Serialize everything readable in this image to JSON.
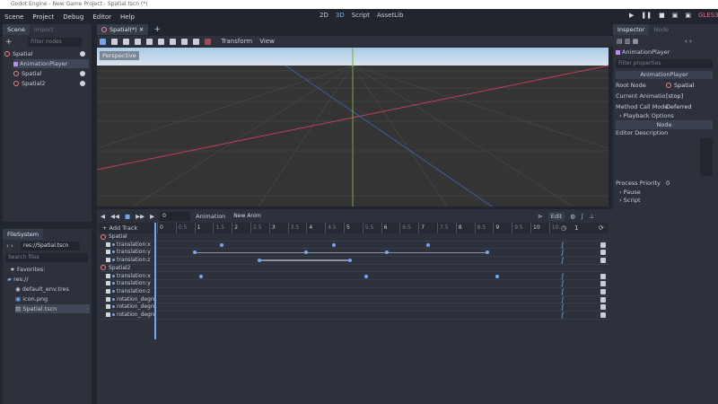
{
  "window": {
    "title": "Godot Engine - New Game Project - Spatial.tscn (*)"
  },
  "menu": [
    "Scene",
    "Project",
    "Debug",
    "Editor",
    "Help"
  ],
  "workspaces": {
    "d2": "2D",
    "d3": "3D",
    "script": "Script",
    "assetlib": "AssetLib"
  },
  "renderer": "GLES3",
  "scene_dock": {
    "tabs": [
      "Scene",
      "Import"
    ],
    "filter_placeholder": "Filter nodes",
    "tree": [
      {
        "name": "Spatial",
        "level": 0
      },
      {
        "name": "AnimationPlayer",
        "level": 1
      },
      {
        "name": "Spatial",
        "level": 1
      },
      {
        "name": "Spatial2",
        "level": 1
      }
    ]
  },
  "filesystem": {
    "tab": "FileSystem",
    "path": "res://Spatial.tscn",
    "search_placeholder": "Search files",
    "favorites": "Favorites:",
    "root": "res://",
    "files": [
      "default_env.tres",
      "icon.png",
      "Spatial.tscn"
    ]
  },
  "editor_tabs": {
    "scene_tab": "Spatial(*)"
  },
  "viewport_toolbar": {
    "transform": "Transform",
    "view": "View",
    "perspective": "Perspective"
  },
  "animation": {
    "frame": "0",
    "animation_label": "Animation",
    "anim_name": "New Anim",
    "edit": "Edit",
    "add_track": "Add Track",
    "length": "1",
    "ticks": [
      "0",
      "0.5",
      "1",
      "1.5",
      "2",
      "2.5",
      "3",
      "3.5",
      "4",
      "4.5",
      "5",
      "5.5",
      "6",
      "6.5",
      "7",
      "7.5",
      "8",
      "8.5",
      "9",
      "9.5",
      "10",
      "10."
    ],
    "groups": [
      {
        "node": "Spatial",
        "tracks": [
          {
            "name": "translation:x",
            "keys": [
              1.73,
              4.74,
              7.26
            ],
            "segments": []
          },
          {
            "name": "translation:y",
            "keys": [
              1.0,
              4.0,
              6.15,
              8.85
            ],
            "segments": [
              [
                1.0,
                8.85
              ]
            ]
          },
          {
            "name": "translation:z",
            "keys": [
              2.74,
              5.17
            ],
            "segments": [
              [
                2.74,
                5.17
              ]
            ]
          }
        ]
      },
      {
        "node": "Spatial2",
        "tracks": [
          {
            "name": "translation:x",
            "keys": [
              1.18,
              5.6,
              9.1
            ],
            "segments": []
          },
          {
            "name": "translation:y",
            "keys": [],
            "segments": []
          },
          {
            "name": "translation:z",
            "keys": [],
            "segments": []
          },
          {
            "name": "rotation_degre",
            "keys": [],
            "segments": []
          },
          {
            "name": "rotation_degre",
            "keys": [],
            "segments": []
          },
          {
            "name": "rotation_degre",
            "keys": [],
            "segments": []
          }
        ]
      }
    ]
  },
  "inspector": {
    "tabs": [
      "Inspector",
      "Node"
    ],
    "object": "AnimationPlayer",
    "filter_placeholder": "Filter properties",
    "section": "AnimationPlayer",
    "root_node_label": "Root Node",
    "root_node": "Spatial",
    "current_anim_label": "Current Animatio",
    "current_anim": "[stop]",
    "method_call_label": "Method Call Mode",
    "method_call": "Deferred",
    "playback": "Playback Options",
    "node_section": "Node",
    "editor_desc": "Editor Description",
    "priority_label": "Process Priority",
    "priority": "0",
    "pause": "Pause",
    "script": "Script"
  }
}
